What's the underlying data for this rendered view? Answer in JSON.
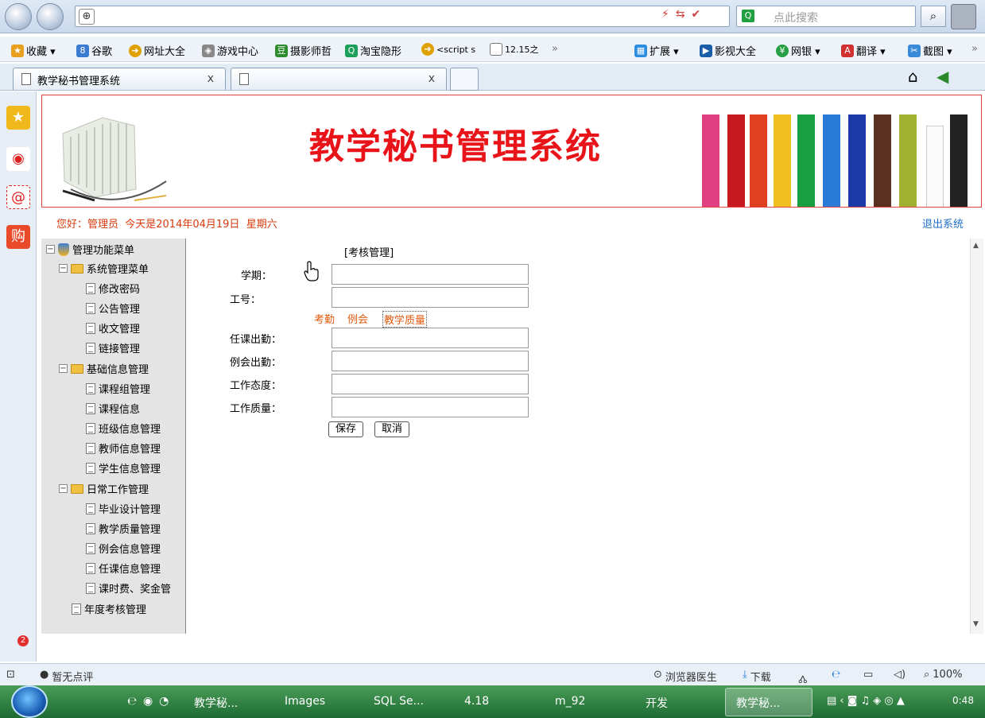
{
  "browser": {
    "search_placeholder": "点此搜索",
    "favorites": [
      {
        "label": "收藏 ▾",
        "icon": "star-icon"
      },
      {
        "label": "谷歌",
        "icon": "google-icon"
      },
      {
        "label": "网址大全",
        "icon": "globe-icon"
      },
      {
        "label": "游戏中心",
        "icon": "game-icon"
      },
      {
        "label": "摄影师哲",
        "icon": "douban-icon"
      },
      {
        "label": "淘宝隐形",
        "icon": "taobao-icon"
      },
      {
        "label": "<script s",
        "icon": "globe-icon"
      },
      {
        "label": "12.15之",
        "icon": "page-icon"
      },
      {
        "label": "»",
        "icon": ""
      }
    ],
    "favorites_right": [
      {
        "label": "扩展 ▾",
        "icon": "extension-icon"
      },
      {
        "label": "影视大全",
        "icon": "video-icon"
      },
      {
        "label": "网银 ▾",
        "icon": "bank-icon"
      },
      {
        "label": "翻译 ▾",
        "icon": "translate-icon"
      },
      {
        "label": "截图 ▾",
        "icon": "screenshot-icon"
      },
      {
        "label": "»",
        "icon": ""
      }
    ],
    "tabs": [
      {
        "label": "教学秘书管理系统"
      },
      {
        "label": ""
      }
    ],
    "close_glyph": "x"
  },
  "app": {
    "title": "教学秘书管理系统",
    "welcome": "您好：管理员  今天是2014年04月19日  星期六",
    "logout": "退出系统"
  },
  "tree": {
    "root": "管理功能菜单",
    "groups": [
      {
        "label": "系统管理菜单",
        "items": [
          "修改密码",
          "公告管理",
          "收文管理",
          "链接管理"
        ]
      },
      {
        "label": "基础信息管理",
        "items": [
          "课程组管理",
          "课程信息",
          "班级信息管理",
          "教师信息管理",
          "学生信息管理"
        ]
      },
      {
        "label": "日常工作管理",
        "items": [
          "毕业设计管理",
          "教学质量管理",
          "例会信息管理",
          "任课信息管理",
          "课时费、奖金管"
        ]
      }
    ],
    "last_item": "年度考核管理"
  },
  "form": {
    "heading": "[考核管理]",
    "semester_label": "学期：",
    "id_label": "工号：",
    "links": [
      "考勤",
      "例会",
      "教学质量"
    ],
    "attendance_label": "任课出勤：",
    "meeting_label": "例会出勤：",
    "attitude_label": "工作态度：",
    "quality_label": "工作质量：",
    "save": "保存",
    "cancel": "取消"
  },
  "statusbar": {
    "rating": "暂无点评",
    "doctor": "浏览器医生",
    "download": "下载",
    "zoom": "100%",
    "badge": "2"
  },
  "taskbar": {
    "items": [
      "教学秘...",
      "Images",
      "SQL Se...",
      "4.18",
      "m_92",
      "开发",
      "教学秘..."
    ],
    "time": "0:48"
  },
  "colors": {
    "title_red": "#e8141a",
    "welcome_orange": "#d73a0c",
    "link_orange": "#e05a10",
    "logout_blue": "#1e6ec8"
  }
}
